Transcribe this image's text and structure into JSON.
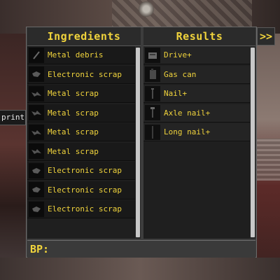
{
  "side_tag": "print",
  "ingredients": {
    "title": "Ingredients",
    "items": [
      {
        "label": "Metal debris",
        "icon": "metal-debris-icon"
      },
      {
        "label": "Electronic scrap",
        "icon": "electronic-scrap-icon"
      },
      {
        "label": "Metal scrap",
        "icon": "metal-scrap-icon"
      },
      {
        "label": "Metal scrap",
        "icon": "metal-scrap-icon"
      },
      {
        "label": "Metal scrap",
        "icon": "metal-scrap-icon"
      },
      {
        "label": "Metal scrap",
        "icon": "metal-scrap-icon"
      },
      {
        "label": "Electronic scrap",
        "icon": "electronic-scrap-icon"
      },
      {
        "label": "Electronic scrap",
        "icon": "electronic-scrap-icon"
      },
      {
        "label": "Electronic scrap",
        "icon": "electronic-scrap-icon"
      }
    ]
  },
  "results": {
    "title": "Results",
    "items": [
      {
        "label": "Drive+",
        "icon": "drive-icon"
      },
      {
        "label": "Gas can",
        "icon": "gas-can-icon"
      },
      {
        "label": "Nail+",
        "icon": "nail-icon"
      },
      {
        "label": "Axle nail+",
        "icon": "axle-nail-icon"
      },
      {
        "label": "Long nail+",
        "icon": "long-nail-icon"
      }
    ]
  },
  "next_button": ">>",
  "bp": {
    "label": "BP:"
  },
  "colors": {
    "accent": "#f0d33c",
    "panel": "#3d3d3d",
    "slot": "#191919"
  }
}
